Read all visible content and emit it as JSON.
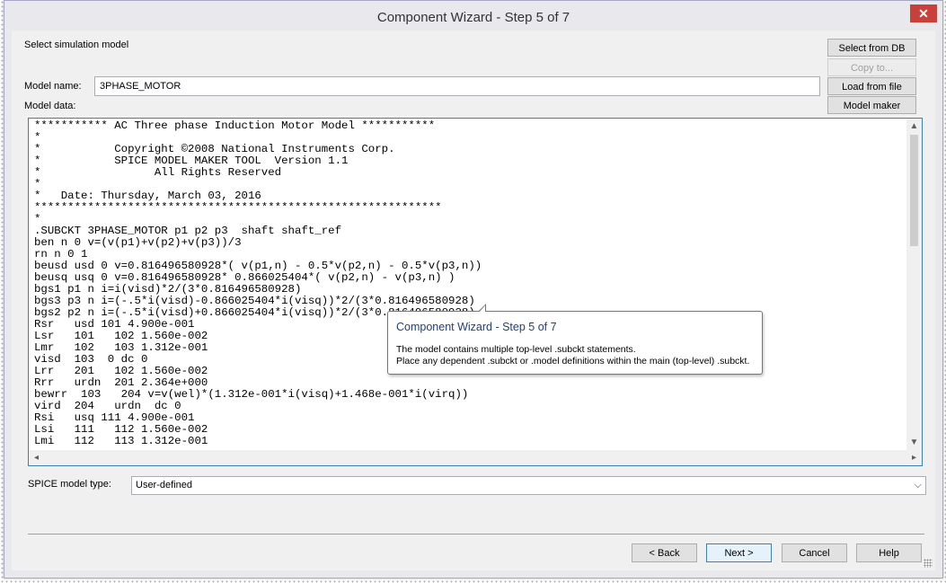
{
  "window": {
    "title": "Component Wizard - Step 5 of 7",
    "close_label": "✕"
  },
  "header": {
    "section_label": "Select simulation model"
  },
  "side_buttons": {
    "select_from_db": "Select from DB",
    "copy_to": "Copy to...",
    "load_from_file": "Load from file",
    "model_maker": "Model maker"
  },
  "model": {
    "name_label": "Model name:",
    "name_value": "3PHASE_MOTOR",
    "data_label": "Model data:",
    "lines": [
      "*********** AC Three phase Induction Motor Model ***********",
      "*",
      "*           Copyright ©2008 National Instruments Corp.",
      "*           SPICE MODEL MAKER TOOL  Version 1.1",
      "*                 All Rights Reserved",
      "*",
      "*   Date: Thursday, March 03, 2016",
      "*************************************************************",
      "*",
      ".SUBCKT 3PHASE_MOTOR p1 p2 p3  shaft shaft_ref",
      "ben n 0 v=(v(p1)+v(p2)+v(p3))/3",
      "rn n 0 1",
      "beusd usd 0 v=0.816496580928*( v(p1,n) - 0.5*v(p2,n) - 0.5*v(p3,n))",
      "beusq usq 0 v=0.816496580928* 0.866025404*( v(p2,n) - v(p3,n) )",
      "bgs1 p1 n i=i(visd)*2/(3*0.816496580928)",
      "bgs3 p3 n i=(-.5*i(visd)-0.866025404*i(visq))*2/(3*0.816496580928)",
      "bgs2 p2 n i=(-.5*i(visd)+0.866025404*i(visq))*2/(3*0.816496580928)",
      "Rsr   usd 101 4.900e-001",
      "Lsr   101   102 1.560e-002",
      "Lmr   102   103 1.312e-001",
      "visd  103  0 dc 0",
      "Lrr   201   102 1.560e-002",
      "Rrr   urdn  201 2.364e+000",
      "bewrr  103   204 v=v(wel)*(1.312e-001*i(visq)+1.468e-001*i(virq))",
      "vird  204   urdn  dc 0",
      "Rsi   usq 111 4.900e-001",
      "Lsi   111   112 1.560e-002",
      "Lmi   112   113 1.312e-001"
    ]
  },
  "tooltip": {
    "title": "Component Wizard - Step 5 of 7",
    "line1": "The model contains multiple top-level .subckt statements.",
    "line2": "Place any dependent .subckt or .model definitions within the main (top-level) .subckt."
  },
  "spice": {
    "label": "SPICE model type:",
    "value": "User-defined"
  },
  "footer_buttons": {
    "back": "< Back",
    "next": "Next >",
    "cancel": "Cancel",
    "help": "Help"
  }
}
